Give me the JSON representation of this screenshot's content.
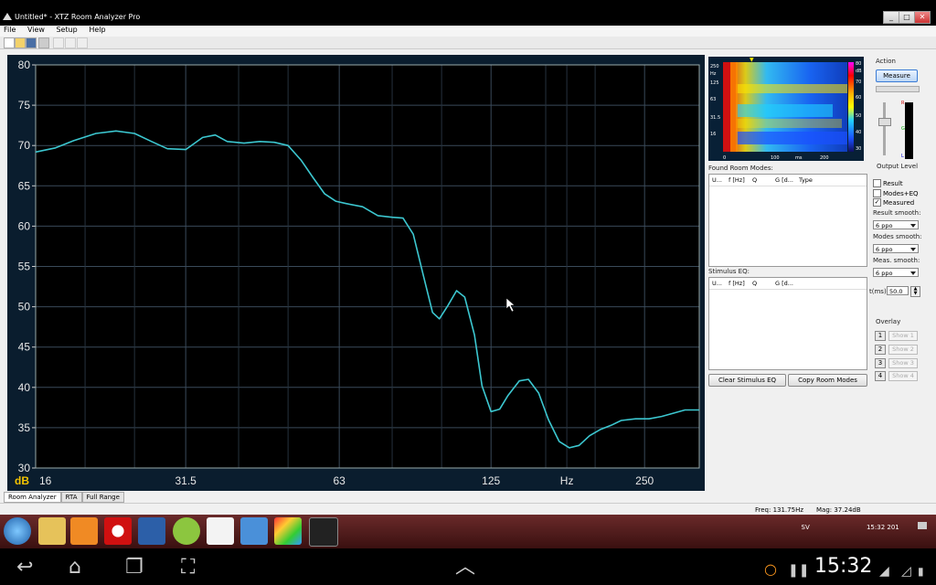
{
  "window": {
    "title": "Untitled* - XTZ Room Analyzer Pro",
    "controls": [
      "_",
      "□",
      "✕"
    ]
  },
  "menu": [
    "File",
    "View",
    "Setup",
    "Help"
  ],
  "toolbar_icons": [
    "new-icon",
    "open-icon",
    "save-icon",
    "print-icon",
    "pair-icon-1",
    "pair-icon-2",
    "pair-icon-3"
  ],
  "chart_data": {
    "type": "line",
    "title": "",
    "xlabel": "Hz",
    "ylabel": "dB",
    "x_scale": "log",
    "xlim": [
      16,
      320
    ],
    "ylim": [
      30,
      80
    ],
    "y_ticks": [
      30,
      35,
      40,
      45,
      50,
      55,
      60,
      65,
      70,
      75,
      80
    ],
    "x_ticks": [
      "16",
      "31.5",
      "63",
      "125",
      "Hz",
      "250"
    ],
    "grid": true,
    "line_color": "#3cc7d0",
    "series": [
      {
        "name": "",
        "x": [
          16,
          17.5,
          19,
          21,
          23,
          25,
          27,
          29,
          31.5,
          34,
          36,
          38,
          41,
          44,
          47,
          50,
          53,
          56,
          59,
          62,
          65,
          70,
          75,
          80,
          84,
          88,
          92,
          96,
          99,
          103,
          107,
          111,
          116,
          120,
          125,
          130,
          135,
          142,
          148,
          155,
          162,
          170,
          178,
          186,
          195,
          205,
          215,
          225,
          240,
          255,
          270,
          285,
          300,
          315,
          320
        ],
        "y": [
          69.2,
          69.7,
          70.6,
          71.5,
          71.8,
          71.5,
          70.5,
          69.6,
          69.5,
          71.0,
          71.3,
          70.5,
          70.3,
          70.5,
          70.4,
          70.0,
          68.2,
          66.0,
          64.0,
          63.1,
          62.8,
          62.4,
          61.3,
          61.1,
          61.0,
          59.0,
          54.0,
          49.3,
          48.5,
          50.2,
          52.0,
          51.2,
          46.5,
          40.2,
          37.0,
          37.3,
          39.0,
          40.8,
          41.0,
          39.3,
          36.0,
          33.3,
          32.5,
          32.8,
          34.0,
          34.8,
          35.3,
          35.9,
          36.1,
          36.1,
          36.4,
          36.8,
          37.2,
          37.2,
          37.2
        ]
      }
    ]
  },
  "spectrogram": {
    "y_labels": [
      "250",
      "Hz",
      "125",
      "63",
      "31.5",
      "16"
    ],
    "x_labels": [
      "0",
      "100",
      "ms",
      "200"
    ],
    "scale_labels": [
      "80",
      "dB",
      "70",
      "60",
      "50",
      "40",
      "30"
    ]
  },
  "panel": {
    "action_label": "Action",
    "measure_button": "Measure",
    "output_level_label": "Output Level",
    "found_modes_label": "Found Room Modes:",
    "modes_headers": [
      "U...",
      "f [Hz]",
      "Q",
      "G [d...",
      "Type"
    ],
    "stimulus_eq_label": "Stimulus EQ:",
    "eq_headers": [
      "U...",
      "f [Hz]",
      "Q",
      "G [d..."
    ],
    "clear_button": "Clear Stimulus EQ",
    "copy_button": "Copy Room Modes",
    "checkboxes": [
      {
        "label": "Result",
        "checked": false
      },
      {
        "label": "Modes+EQ",
        "checked": false
      },
      {
        "label": "Measured",
        "checked": true
      }
    ],
    "result_smooth_label": "Result smooth:",
    "result_smooth_value": "6 ppo",
    "modes_smooth_label": "Modes smooth:",
    "modes_smooth_value": "6 ppo",
    "meas_smooth_label": "Meas. smooth:",
    "meas_smooth_value": "6 ppo",
    "t_label": "t(ms)",
    "t_value": "50.0",
    "overlay_label": "Overlay",
    "overlay": [
      {
        "num": "1",
        "show": "Show 1"
      },
      {
        "num": "2",
        "show": "Show 2"
      },
      {
        "num": "3",
        "show": "Show 3"
      },
      {
        "num": "4",
        "show": "Show 4"
      }
    ]
  },
  "tabs": [
    "Room Analyzer",
    "RTA",
    "Full Range"
  ],
  "status": {
    "freq": "Freq: 131.75Hz",
    "mag": "Mag: 37.24dB"
  },
  "tray": {
    "lang": "SV",
    "time": "15:32",
    "date": "201"
  },
  "android": {
    "time": "15:32"
  }
}
